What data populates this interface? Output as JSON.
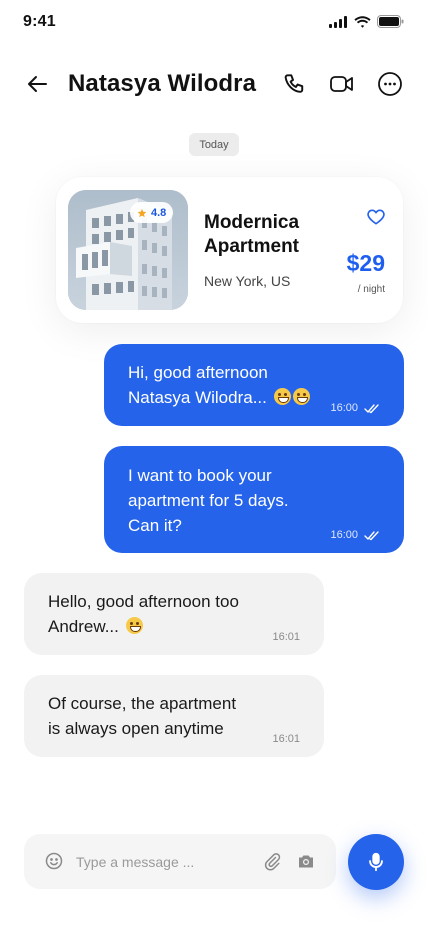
{
  "status_bar": {
    "time": "9:41"
  },
  "header": {
    "contact_name": "Natasya Wilodra"
  },
  "date_label": "Today",
  "listing": {
    "title": "Modernica Apartment",
    "location": "New York, US",
    "rating": "4.8",
    "price": "$29",
    "price_unit": "/ night"
  },
  "messages": [
    {
      "direction": "outgoing",
      "line1": "Hi, good afternoon",
      "line2": "Natasya Wilodra...",
      "emoji_count": 2,
      "time": "16:00",
      "read": true
    },
    {
      "direction": "outgoing",
      "line1": "I want to book your",
      "line2": "apartment for 5 days.",
      "line3": "Can it?",
      "time": "16:00",
      "read": true
    },
    {
      "direction": "incoming",
      "line1": "Hello, good afternoon too",
      "line2": "Andrew...",
      "emoji_count": 1,
      "time": "16:01"
    },
    {
      "direction": "incoming",
      "line1": "Of course, the apartment",
      "line2": "is always open anytime",
      "time": "16:01"
    }
  ],
  "composer": {
    "placeholder": "Type a message ..."
  },
  "colors": {
    "accent": "#2563eb",
    "incoming_bubble": "#f2f2f2",
    "star": "#f5a623"
  }
}
